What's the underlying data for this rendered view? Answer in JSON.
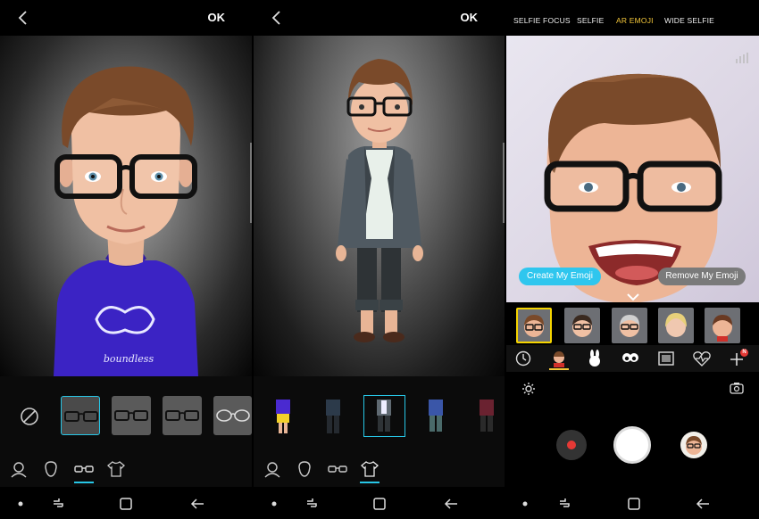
{
  "panel1": {
    "ok_label": "OK",
    "shirt_text": "boundless",
    "glasses_items": [
      "none",
      "square-black-glasses",
      "square-black-glasses-2",
      "square-black-glasses-3",
      "round-clear-glasses"
    ],
    "tabs": [
      "face-icon",
      "head-icon",
      "glasses-icon",
      "shirt-icon"
    ],
    "active_tab": "glasses-icon"
  },
  "panel2": {
    "ok_label": "OK",
    "outfits": [
      "purple-shirt-yellow-shorts",
      "dark-outfit",
      "blazer-jeans",
      "blue-jacket-outfit",
      "dark-red-outfit"
    ],
    "tabs": [
      "face-icon",
      "head-icon",
      "glasses-icon",
      "shirt-icon"
    ],
    "active_tab": "shirt-icon"
  },
  "panel3": {
    "modes": [
      "SELFIE FOCUS",
      "SELFIE",
      "AR EMOJI",
      "WIDE SELFIE"
    ],
    "active_mode": "AR EMOJI",
    "create_label": "Create My Emoji",
    "remove_label": "Remove My Emoji",
    "badge": "N",
    "categories": [
      "clock-icon",
      "avatar-icon",
      "rabbit-icon",
      "eyes-icon",
      "picture-icon",
      "heart-pulse-icon",
      "plus-icon"
    ]
  },
  "colors": {
    "accent": "#27c6e6",
    "mode_active": "#f5c83a",
    "record_red": "#e53935",
    "sweater": "#3b23c4"
  }
}
